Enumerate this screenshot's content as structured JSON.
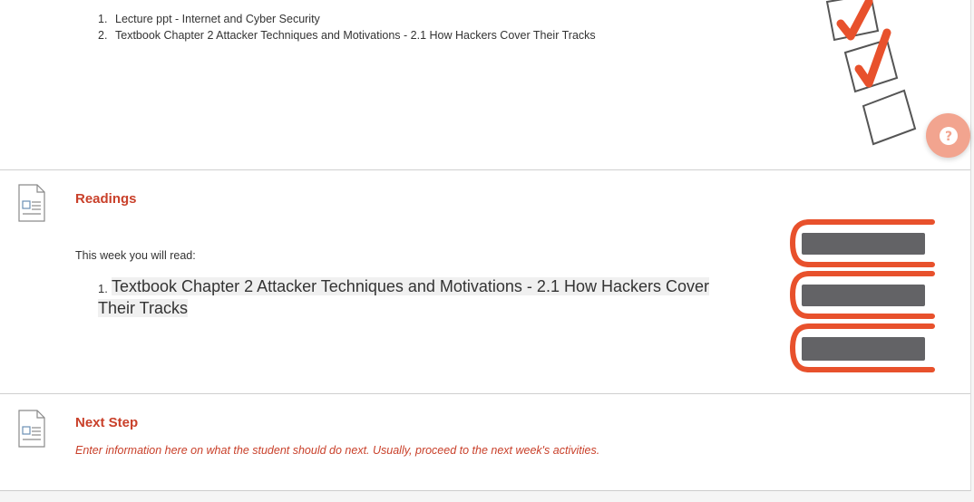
{
  "top_list": {
    "items": [
      {
        "num": "1.",
        "text": "Lecture ppt - Internet and Cyber Security"
      },
      {
        "num": "2.",
        "text": "Textbook Chapter 2  Attacker Techniques and Motivations - 2.1 How Hackers Cover Their Tracks"
      }
    ]
  },
  "readings": {
    "title": "Readings",
    "intro": "This week you will read:",
    "items": [
      {
        "num": "1.",
        "line1": "Textbook Chapter 2  Attacker Techniques and Motivations - 2.1 How Hackers Cover",
        "line2": "Their Tracks"
      }
    ]
  },
  "next_step": {
    "title": "Next Step",
    "text": "Enter information here on what the student should do next.  Usually, proceed to the next week's activities."
  },
  "help": {
    "icon": "question-icon",
    "glyph": "?"
  },
  "colors": {
    "accent": "#c9402a",
    "book_orange": "#e8512c",
    "book_gray": "#636366",
    "help_bg": "#f2a48f"
  }
}
